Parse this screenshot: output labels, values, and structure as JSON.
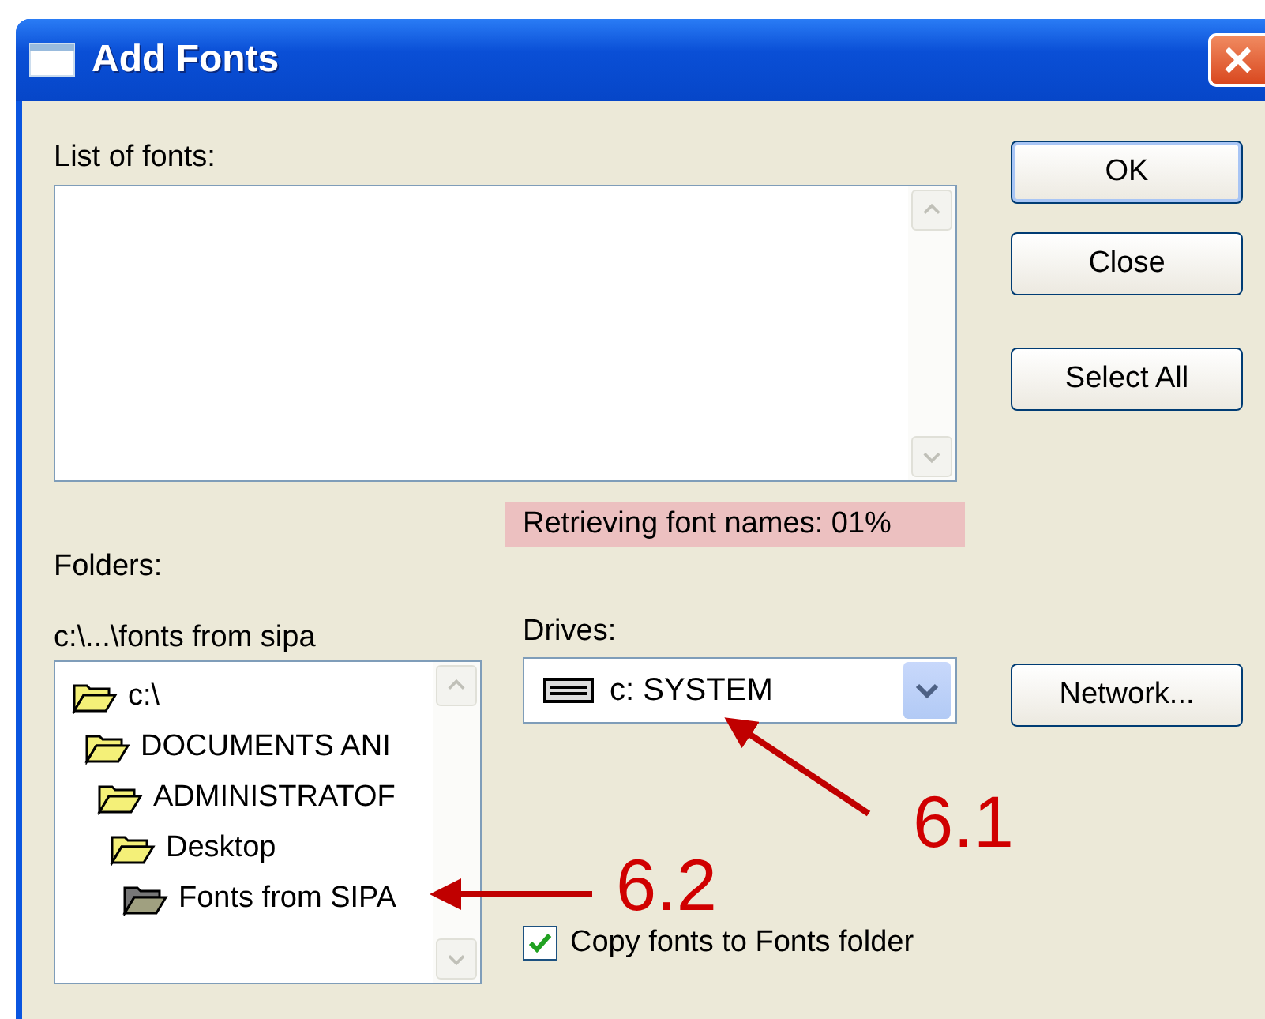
{
  "window": {
    "title": "Add Fonts"
  },
  "font_list": {
    "label": "List of fonts:"
  },
  "buttons": [
    {
      "label": "OK",
      "default": true
    },
    {
      "label": "Close",
      "default": false
    },
    {
      "label": "Select All",
      "default": false
    }
  ],
  "folders": {
    "label": "Folders:",
    "path": "c:\\...\\fonts from sipa",
    "tree": [
      {
        "label": "c:\\",
        "selected": false,
        "children": [
          {
            "label": "DOCUMENTS ANI",
            "selected": false,
            "children": [
              {
                "label": "ADMINISTRATOF",
                "selected": false,
                "children": [
                  {
                    "label": "Desktop",
                    "selected": false,
                    "children": [
                      {
                        "label": "Fonts from SIPA",
                        "selected": true
                      }
                    ]
                  }
                ]
              }
            ]
          }
        ]
      }
    ]
  },
  "status": "Retrieving font names: 01%",
  "drives": {
    "label": "Drives:",
    "value": "c: SYSTEM"
  },
  "network_button": "Network...",
  "copy_fonts": {
    "label": "Copy fonts to Fonts folder",
    "checked": true
  },
  "annotations": [
    {
      "label": "6.1"
    },
    {
      "label": "6.2"
    }
  ]
}
